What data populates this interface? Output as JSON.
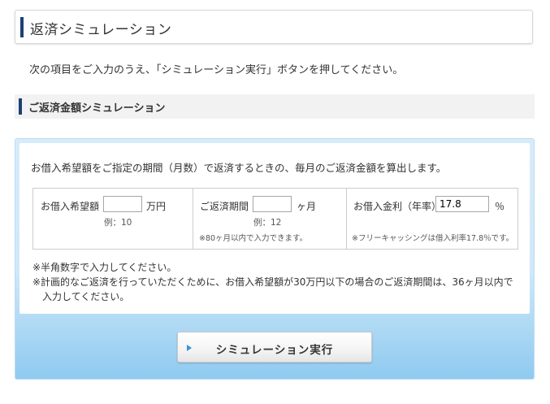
{
  "header": {
    "title": "返済シミュレーション"
  },
  "intro": "次の項目をご入力のうえ、「シミュレーション実行」ボタンを押してください。",
  "section": {
    "title": "ご返済金額シミュレーション"
  },
  "simulation": {
    "lead": "お借入希望額をご指定の期間（月数）で返済するときの、毎月のご返済金額を算出します。",
    "amount": {
      "label": "お借入希望額",
      "value": "",
      "unit": "万円",
      "example": "例：10"
    },
    "period": {
      "label": "ご返済期間",
      "value": "",
      "unit": "ヶ月",
      "example": "例：12",
      "note": "※80ヶ月以内で入力できます。"
    },
    "rate": {
      "label": "お借入金利（年率）",
      "value": "17.8",
      "unit": "％",
      "note": "※フリーキャッシングは借入利率17.8％です。"
    },
    "notes": [
      "※半角数字で入力してください。",
      "※計画的なご返済を行っていただくために、お借入希望額が30万円以下の場合のご返済期間は、36ヶ月以内で入力してください。"
    ],
    "button_label": "シミュレーション実行"
  },
  "colors": {
    "accent_bar": "#1e3f75",
    "panel_blue": "#8fcaf0",
    "button_arrow": "#3a93d8"
  }
}
